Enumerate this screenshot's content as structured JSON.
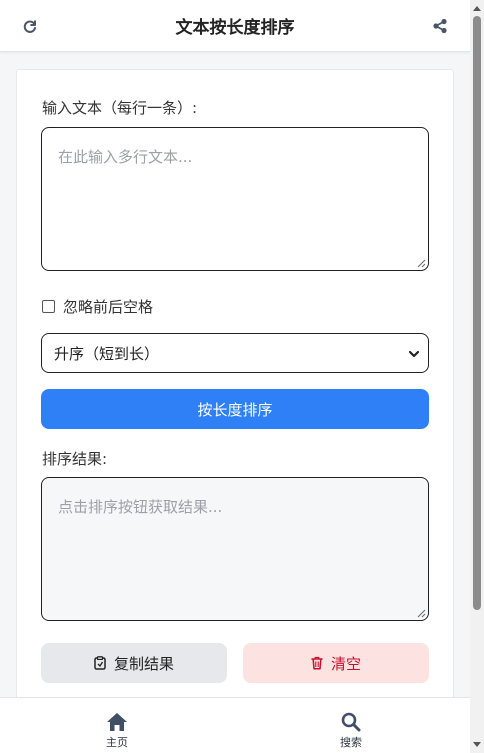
{
  "header": {
    "title": "文本按长度排序",
    "refresh_icon": "refresh-icon",
    "share_icon": "share-icon"
  },
  "form": {
    "input_label": "输入文本（每行一条）:",
    "input_placeholder": "在此输入多行文本...",
    "ignore_whitespace_label": "忽略前后空格",
    "ignore_whitespace_checked": false,
    "sort_order_selected": "升序（短到长）",
    "sort_button_label": "按长度排序",
    "result_label": "排序结果:",
    "result_placeholder": "点击排序按钮获取结果...",
    "copy_button_label": "复制结果",
    "clear_button_label": "清空"
  },
  "bottom_nav": {
    "items": [
      {
        "label": "主页",
        "icon": "home-icon"
      },
      {
        "label": "搜索",
        "icon": "search-icon"
      }
    ]
  },
  "colors": {
    "primary": "#2f80f7",
    "danger_text": "#c8102e",
    "danger_bg": "#fde2e2",
    "secondary_bg": "#e6e8eb"
  }
}
